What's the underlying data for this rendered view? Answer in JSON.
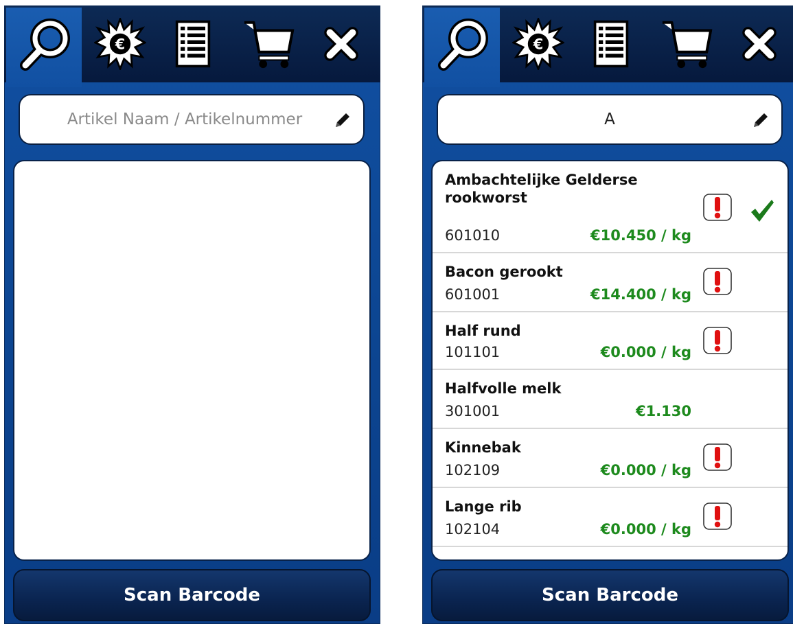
{
  "tabs": [
    {
      "icon": "search-icon",
      "label": "Zoeken"
    },
    {
      "icon": "euro-burst-icon",
      "label": "Aanbiedingen"
    },
    {
      "icon": "list-icon",
      "label": "Lijst"
    },
    {
      "icon": "cart-icon",
      "label": "Winkelwagen"
    },
    {
      "icon": "close-icon",
      "label": "Sluiten"
    }
  ],
  "left": {
    "search_placeholder": "Artikel Naam / Artikelnummer",
    "scan_label": "Scan Barcode"
  },
  "right": {
    "search_value": "A",
    "scan_label": "Scan Barcode",
    "results": [
      {
        "name": "Ambachtelijke Gelderse rookworst",
        "number": "601010",
        "price": "€10.450 / kg",
        "warning": true,
        "checked": true
      },
      {
        "name": "Bacon gerookt",
        "number": "601001",
        "price": "€14.400 / kg",
        "warning": true,
        "checked": false
      },
      {
        "name": "Half rund",
        "number": "101101",
        "price": "€0.000 / kg",
        "warning": true,
        "checked": false
      },
      {
        "name": "Halfvolle melk",
        "number": "301001",
        "price": "€1.130",
        "warning": false,
        "checked": false
      },
      {
        "name": "Kinnebak",
        "number": "102109",
        "price": "€0.000 / kg",
        "warning": true,
        "checked": false
      },
      {
        "name": "Lange rib",
        "number": "102104",
        "price": "€0.000 / kg",
        "warning": true,
        "checked": false
      }
    ]
  },
  "colors": {
    "background": "#0c4591",
    "tabbar": "#06193d",
    "price": "#1d8a1d",
    "warning": "#e01010",
    "check": "#1b7a1b"
  }
}
